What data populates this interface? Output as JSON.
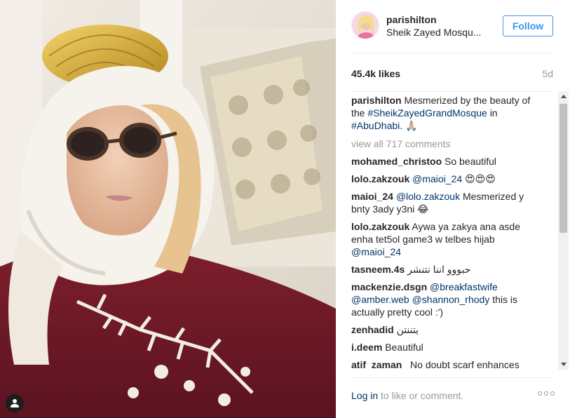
{
  "post": {
    "username": "parishilton",
    "location": "Sheik Zayed Mosqu...",
    "follow_label": "Follow",
    "likes": "45.4k likes",
    "age": "5d",
    "caption": {
      "user": "parishilton",
      "text_1": "Mesmerized by the beauty of the",
      "tag_1": "#SheikZayedGrandMosque",
      "text_2": "in",
      "tag_2": "#AbuDhabi",
      "text_3": ". 🙏🏼"
    },
    "view_all": "view all 717 comments"
  },
  "comments": [
    {
      "user": "mohamed_christoo",
      "text": "So beautiful"
    },
    {
      "user": "lolo.zakzouk",
      "mention": "@maioi_24",
      "text": "😍😍😍"
    },
    {
      "user": "maioi_24",
      "mention": "@lolo.zakzouk",
      "text": "Mesmerized y bnty 3ady y3ni 😂"
    },
    {
      "user": "lolo.zakzouk",
      "text": "Aywa ya zakya ana asde enha tet5ol game3 w telbes hijab",
      "mention_after": "@maioi_24"
    },
    {
      "user": "tasneem.4s",
      "text": "حبووو اننا نتنشر"
    },
    {
      "user": "mackenzie.dsgn",
      "mention": "@breakfastwife",
      "mention_2": "@amber.web",
      "mention_3": "@shannon_rhody",
      "text": "this is actually pretty cool :')"
    },
    {
      "user": "zenhadid",
      "text": "يتننتن"
    },
    {
      "user": "i.deem",
      "text": "Beautiful"
    },
    {
      "user": "atif_zaman_",
      "text": "No doubt scarf enhances"
    }
  ],
  "footer": {
    "login_link": "Log in",
    "login_rest": "to like or comment."
  },
  "icons": {
    "user_tag": "person-icon",
    "more": "more-options-icon"
  },
  "colors": {
    "accent": "#3897f0",
    "link": "#003569",
    "muted": "#999999"
  }
}
